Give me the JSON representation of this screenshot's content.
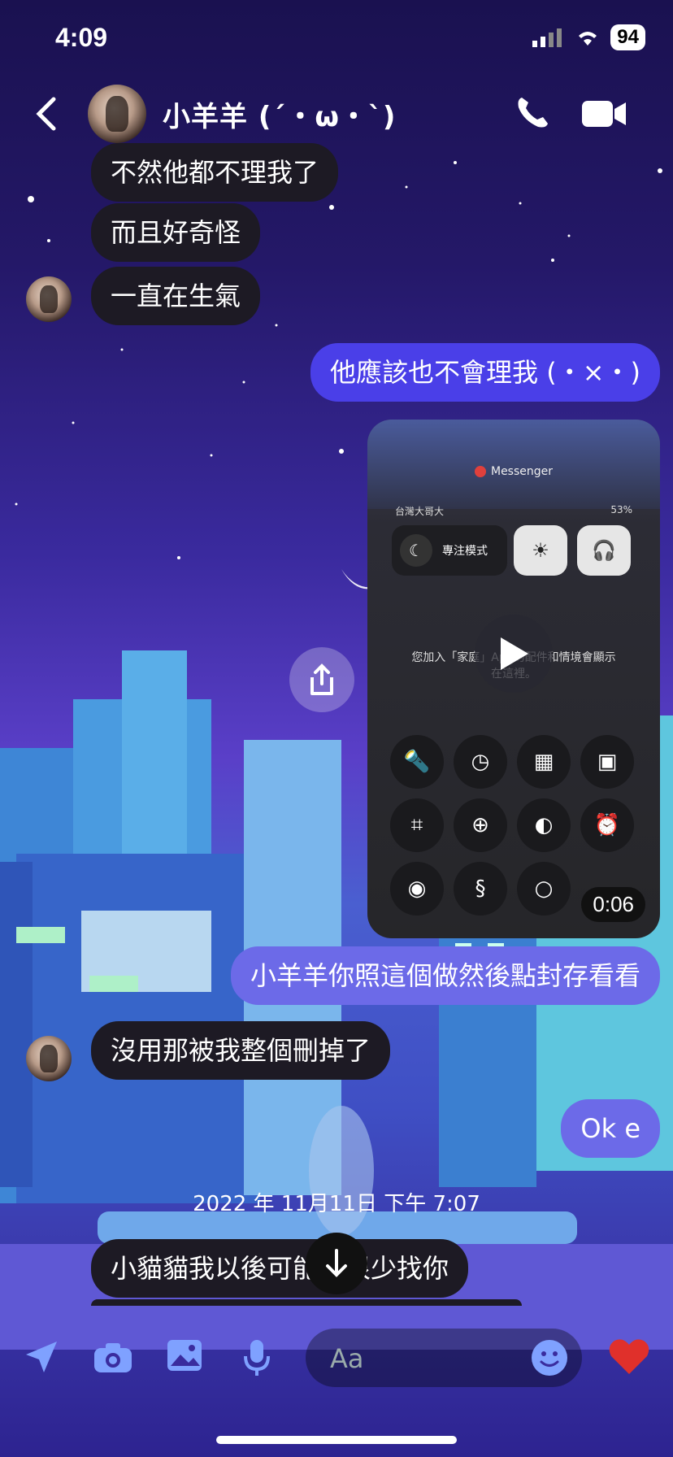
{
  "status": {
    "time": "4:09",
    "battery": "94"
  },
  "header": {
    "contact_name": "小羊羊 (´・ω・`)"
  },
  "messages": [
    {
      "text": "不然他都不理我了",
      "dir": "in"
    },
    {
      "text": "而且好奇怪",
      "dir": "in"
    },
    {
      "text": "一直在生氣",
      "dir": "in"
    },
    {
      "text": "他應該也不會理我 (・×・)",
      "dir": "out"
    },
    {
      "text": "小羊羊你照這個做然後點封存看看",
      "dir": "out"
    },
    {
      "text": "沒用那被我整個刪掉了",
      "dir": "in"
    },
    {
      "text": "Ok e",
      "dir": "out"
    },
    {
      "text": "小貓貓我以後可能會很少找你",
      "dir": "in"
    }
  ],
  "video": {
    "app_name": "Messenger",
    "carrier": "台灣大哥大",
    "battery_text": "53%",
    "focus_label": "專注模式",
    "home_text": "您加入「家庭」App的配件和情境會顯示",
    "home_text2": "在這裡。",
    "duration": "0:06"
  },
  "timestamp": "2022 年 11月11日 下午 7:07",
  "composer": {
    "placeholder": "Aa"
  },
  "colors": {
    "outgoing": "#4a3fe8",
    "incoming": "#1d1a24",
    "like": "#e0302b"
  }
}
